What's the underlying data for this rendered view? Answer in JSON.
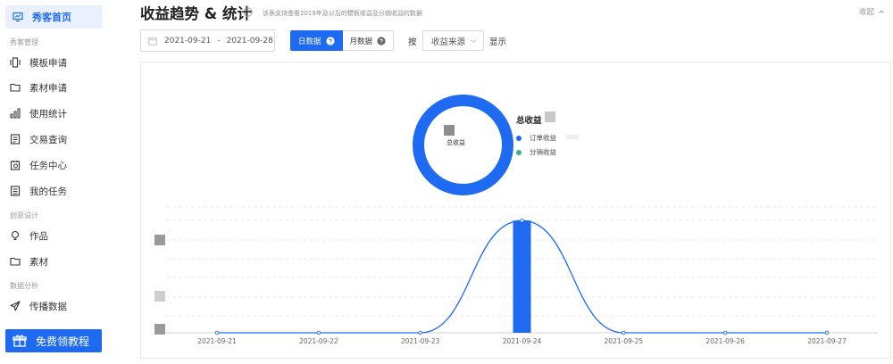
{
  "sidebar": {
    "active_item": {
      "label": "秀客首页",
      "icon": "monitor-icon"
    },
    "sections": [
      {
        "title": "秀客管理",
        "items": [
          {
            "label": "模板申请",
            "icon": "template-icon"
          },
          {
            "label": "素材申请",
            "icon": "folder-icon"
          },
          {
            "label": "使用统计",
            "icon": "bar-chart-icon"
          },
          {
            "label": "交易查询",
            "icon": "document-icon"
          },
          {
            "label": "任务中心",
            "icon": "task-icon"
          },
          {
            "label": "我的任务",
            "icon": "list-icon"
          }
        ]
      },
      {
        "title": "创意设计",
        "items": [
          {
            "label": "作品",
            "icon": "bulb-icon"
          },
          {
            "label": "素材",
            "icon": "folder-icon"
          }
        ]
      },
      {
        "title": "数据分析",
        "items": [
          {
            "label": "传播数据",
            "icon": "send-icon"
          }
        ]
      }
    ],
    "promo_button": {
      "label": "免费领教程",
      "icon": "gift-icon"
    }
  },
  "header": {
    "title": "收益趋势 & 统计",
    "description": "该表支持查看2019年及以后的模板收益及分销收益的数据",
    "collapse_label": "收起"
  },
  "filters": {
    "date_start": "2021-09-21",
    "date_separator": "-",
    "date_end": "2021-09-28",
    "tabs": [
      {
        "label": "日数据",
        "selected": true
      },
      {
        "label": "月数据",
        "selected": false
      }
    ],
    "by_label": "按",
    "group_select_value": "收益来源",
    "show_label": "显示"
  },
  "donut": {
    "center_label": "总收益",
    "legend_title": "总收益",
    "legend_items": [
      {
        "label": "订单收益",
        "color": "#1e6af0"
      },
      {
        "label": "分销收益",
        "color": "#3bb08f"
      }
    ]
  },
  "colors": {
    "accent": "#1e6af0",
    "accent_light": "#e9f1fe",
    "secondary": "#3bb08f"
  },
  "chart_data": {
    "type": "line",
    "x": [
      "2021-09-21",
      "2021-09-22",
      "2021-09-23",
      "2021-09-24",
      "2021-09-25",
      "2021-09-26",
      "2021-09-27"
    ],
    "series": [
      {
        "values": [
          0,
          0,
          0,
          1,
          0,
          0,
          0
        ],
        "style": "smooth-line"
      },
      {
        "values": [
          0,
          0,
          0,
          1,
          0,
          0,
          0
        ],
        "style": "bar"
      }
    ],
    "ylim": [
      0,
      1.05
    ],
    "grid": "horizontal-dashed"
  }
}
